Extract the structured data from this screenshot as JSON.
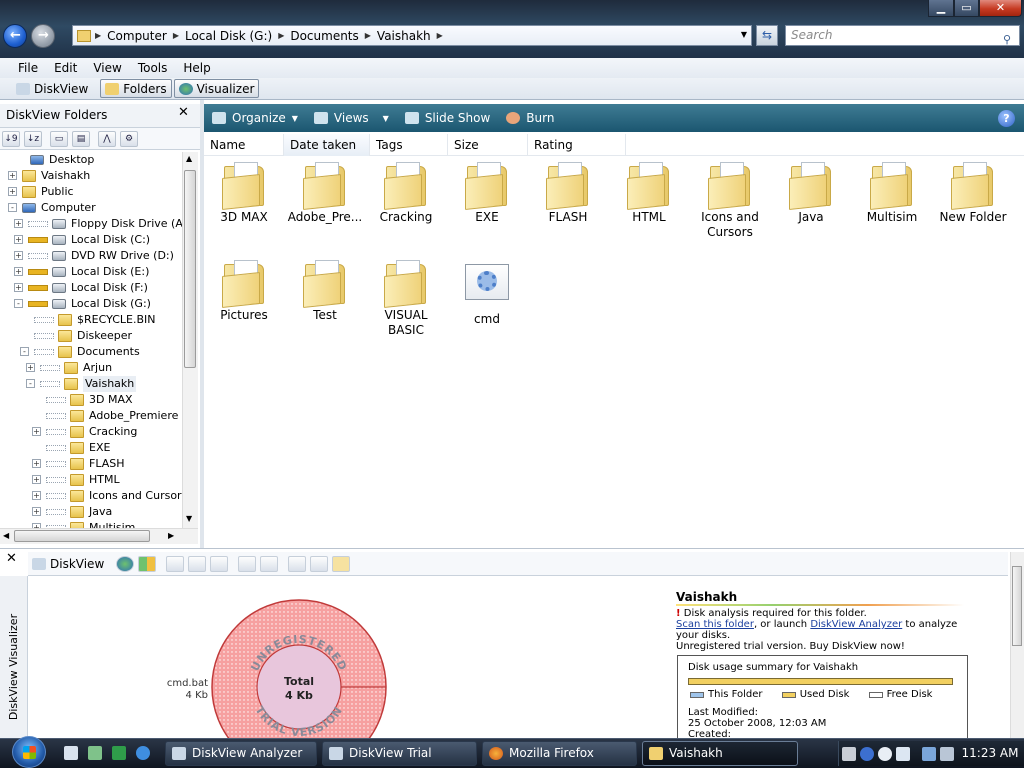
{
  "address": {
    "crumbs": [
      "Computer",
      "Local Disk (G:)",
      "Documents",
      "Vaishakh"
    ],
    "search_placeholder": "Search"
  },
  "menu": [
    "File",
    "Edit",
    "View",
    "Tools",
    "Help"
  ],
  "toolbar2": {
    "diskview": "DiskView",
    "folders": "Folders",
    "visualizer": "Visualizer"
  },
  "left_panel": {
    "title": "DiskView Folders",
    "tree": [
      {
        "label": "Desktop",
        "icon": "desktop-icon",
        "indent": 0,
        "exp": ""
      },
      {
        "label": "Vaishakh",
        "icon": "user-icon",
        "indent": 1,
        "exp": "+"
      },
      {
        "label": "Public",
        "icon": "folder-icon",
        "indent": 1,
        "exp": "+"
      },
      {
        "label": "Computer",
        "icon": "computer-icon",
        "indent": 1,
        "exp": "-"
      },
      {
        "label": "Floppy Disk Drive (A:)",
        "icon": "floppy-icon",
        "indent": 2,
        "exp": "+",
        "bar": "empty"
      },
      {
        "label": "Local Disk (C:)",
        "icon": "drive-icon",
        "indent": 2,
        "exp": "+",
        "bar": "full"
      },
      {
        "label": "DVD RW Drive (D:)",
        "icon": "dvd-icon",
        "indent": 2,
        "exp": "+",
        "bar": "empty"
      },
      {
        "label": "Local Disk (E:)",
        "icon": "drive-icon",
        "indent": 2,
        "exp": "+",
        "bar": "full"
      },
      {
        "label": "Local Disk (F:)",
        "icon": "drive-icon",
        "indent": 2,
        "exp": "+",
        "bar": "full"
      },
      {
        "label": "Local Disk (G:)",
        "icon": "drive-icon",
        "indent": 2,
        "exp": "-",
        "bar": "full"
      },
      {
        "label": "$RECYCLE.BIN",
        "icon": "folder-icon",
        "indent": 3,
        "exp": "",
        "bar": "empty"
      },
      {
        "label": "Diskeeper",
        "icon": "folder-icon",
        "indent": 3,
        "exp": "",
        "bar": "empty"
      },
      {
        "label": "Documents",
        "icon": "folder-icon",
        "indent": 3,
        "exp": "-",
        "bar": "empty"
      },
      {
        "label": "Arjun",
        "icon": "folder-icon",
        "indent": 4,
        "exp": "+",
        "bar": "empty"
      },
      {
        "label": "Vaishakh",
        "icon": "folder-icon",
        "indent": 4,
        "exp": "-",
        "bar": "empty"
      },
      {
        "label": "3D MAX",
        "icon": "folder-icon",
        "indent": 5,
        "exp": "",
        "bar": "empty"
      },
      {
        "label": "Adobe_Premiere",
        "icon": "folder-icon",
        "indent": 5,
        "exp": "",
        "bar": "empty"
      },
      {
        "label": "Cracking",
        "icon": "folder-icon",
        "indent": 5,
        "exp": "+",
        "bar": "empty"
      },
      {
        "label": "EXE",
        "icon": "folder-icon",
        "indent": 5,
        "exp": "",
        "bar": "empty"
      },
      {
        "label": "FLASH",
        "icon": "folder-icon",
        "indent": 5,
        "exp": "+",
        "bar": "empty"
      },
      {
        "label": "HTML",
        "icon": "folder-icon",
        "indent": 5,
        "exp": "+",
        "bar": "empty"
      },
      {
        "label": "Icons and Cursors",
        "icon": "folder-icon",
        "indent": 5,
        "exp": "+",
        "bar": "empty"
      },
      {
        "label": "Java",
        "icon": "folder-icon",
        "indent": 5,
        "exp": "+",
        "bar": "empty"
      },
      {
        "label": "Multisim",
        "icon": "folder-icon",
        "indent": 5,
        "exp": "+",
        "bar": "empty"
      }
    ]
  },
  "commandbar": {
    "organize": "Organize",
    "views": "Views",
    "slideshow": "Slide Show",
    "burn": "Burn",
    "help": "?"
  },
  "columns": [
    "Name",
    "Date taken",
    "Tags",
    "Size",
    "Rating"
  ],
  "items": [
    {
      "label": "3D MAX",
      "type": "folder"
    },
    {
      "label": "Adobe_Pre...",
      "type": "folder"
    },
    {
      "label": "Cracking",
      "type": "folder"
    },
    {
      "label": "EXE",
      "type": "folder"
    },
    {
      "label": "FLASH",
      "type": "folder"
    },
    {
      "label": "HTML",
      "type": "folder"
    },
    {
      "label": "Icons and Cursors",
      "type": "folder"
    },
    {
      "label": "Java",
      "type": "folder"
    },
    {
      "label": "Multisim",
      "type": "folder"
    },
    {
      "label": "New Folder",
      "type": "folder"
    },
    {
      "label": "Pictures",
      "type": "folder"
    },
    {
      "label": "Test",
      "type": "folder"
    },
    {
      "label": "VISUAL BASIC",
      "type": "folder"
    },
    {
      "label": "cmd",
      "type": "batch"
    }
  ],
  "bottom": {
    "vertical_label": "DiskView Visualizer",
    "tool_label": "DiskView",
    "chart": {
      "watermark_top": "UNREGISTERED",
      "watermark_bottom": "TRIAL VERSION",
      "total_label": "Total",
      "total_value": "4 Kb",
      "file_name": "cmd.bat",
      "file_size": "4 Kb"
    },
    "info": {
      "title": "Vaishakh",
      "warning_mark": "!",
      "warning": "Disk analysis required for this folder.",
      "scan_link": "Scan this folder",
      "or_launch": ", or launch ",
      "analyzer_link": "DiskView Analyzer",
      "to_analyze": " to analyze your disks.",
      "trial": "Unregistered trial version. Buy DiskView now!"
    },
    "summary": {
      "title": "Disk usage summary for Vaishakh",
      "legend_this": "This Folder",
      "legend_used": "Used Disk",
      "legend_free": "Free Disk",
      "modified_label": "Last Modified:",
      "modified_value": "25 October 2008, 12:03 AM",
      "created_label": "Created:"
    }
  },
  "taskbar": {
    "tasks": [
      "DiskView Analyzer",
      "DiskView Trial",
      "Mozilla Firefox",
      "Vaishakh"
    ],
    "clock": "11:23 AM"
  }
}
